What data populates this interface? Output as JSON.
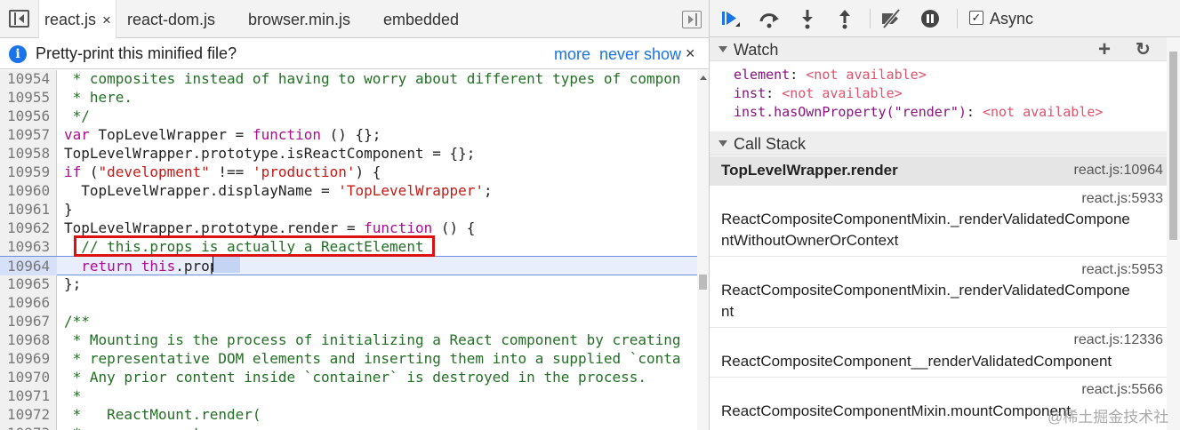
{
  "source_tabs": [
    {
      "label": "react.js",
      "close": "×",
      "active": true
    },
    {
      "label": "react-dom.js"
    },
    {
      "label": "browser.min.js"
    },
    {
      "label": "embedded"
    }
  ],
  "infobar": {
    "icon": "i",
    "message": "Pretty-print this minified file?",
    "more": "more",
    "never_show": "never show",
    "close": "×"
  },
  "editor": {
    "lines": [
      {
        "num": "10954",
        "text": " * composites instead of having to worry about different types of compon"
      },
      {
        "num": "10955",
        "text": " * here."
      },
      {
        "num": "10956",
        "text": " */"
      },
      {
        "num": "10957",
        "text": "var TopLevelWrapper = function () {};"
      },
      {
        "num": "10958",
        "text": "TopLevelWrapper.prototype.isReactComponent = {};"
      },
      {
        "num": "10959",
        "text": "if (\"development\" !== 'production') {"
      },
      {
        "num": "10960",
        "text": "  TopLevelWrapper.displayName = 'TopLevelWrapper';"
      },
      {
        "num": "10961",
        "text": "}"
      },
      {
        "num": "10962",
        "text": "TopLevelWrapper.prototype.render = function () {"
      },
      {
        "num": "10963",
        "text": "  // this.props is actually a ReactElement"
      },
      {
        "num": "10964",
        "text": "  return this.props;"
      },
      {
        "num": "10965",
        "text": "};"
      },
      {
        "num": "10966",
        "text": ""
      },
      {
        "num": "10967",
        "text": "/**"
      },
      {
        "num": "10968",
        "text": " * Mounting is the process of initializing a React component by creating"
      },
      {
        "num": "10969",
        "text": " * representative DOM elements and inserting them into a supplied `conta"
      },
      {
        "num": "10970",
        "text": " * Any prior content inside `container` is destroyed in the process."
      },
      {
        "num": "10971",
        "text": " *"
      },
      {
        "num": "10972",
        "text": " *   ReactMount.render("
      },
      {
        "num": "10973",
        "text": " *     component,"
      }
    ],
    "current_line": "10964",
    "highlighted_line": "10963"
  },
  "debugger": {
    "async_label": "Async",
    "async_checked": true,
    "check_glyph": "✓",
    "buttons": [
      "resume-icon",
      "step-over-icon",
      "step-into-icon",
      "step-out-icon",
      "deactivate-breakpoints-icon",
      "pause-on-exceptions-icon"
    ]
  },
  "watch": {
    "title": "Watch",
    "add_glyph": "+",
    "refresh_glyph": "↻",
    "items": [
      {
        "expr": "element",
        "value": "<not available>"
      },
      {
        "expr": "inst",
        "value": "<not available>"
      },
      {
        "expr": "inst.hasOwnProperty(\"render\")",
        "value": "<not available>"
      }
    ]
  },
  "call_stack": {
    "title": "Call Stack",
    "frames": [
      {
        "name": "TopLevelWrapper.render",
        "location": "react.js:10964",
        "selected": true
      },
      {
        "name": "ReactCompositeComponentMixin._renderValidatedComponentWithoutOwnerOrContext",
        "name_line1": "ReactCompositeComponentMixin._renderValidatedCompone",
        "name_line2": "ntWithoutOwnerOrContext",
        "location": "react.js:5933"
      },
      {
        "name": "ReactCompositeComponentMixin._renderValidatedComponent",
        "name_line1": "ReactCompositeComponentMixin._renderValidatedCompone",
        "name_line2": "nt",
        "location": "react.js:5953"
      },
      {
        "name": "ReactCompositeComponent__renderValidatedComponent",
        "location": "react.js:12336"
      },
      {
        "name": "ReactCompositeComponentMixin.mountComponent",
        "location": "react.js:5566"
      }
    ]
  },
  "watermark": "@稀土掘金技术社区"
}
